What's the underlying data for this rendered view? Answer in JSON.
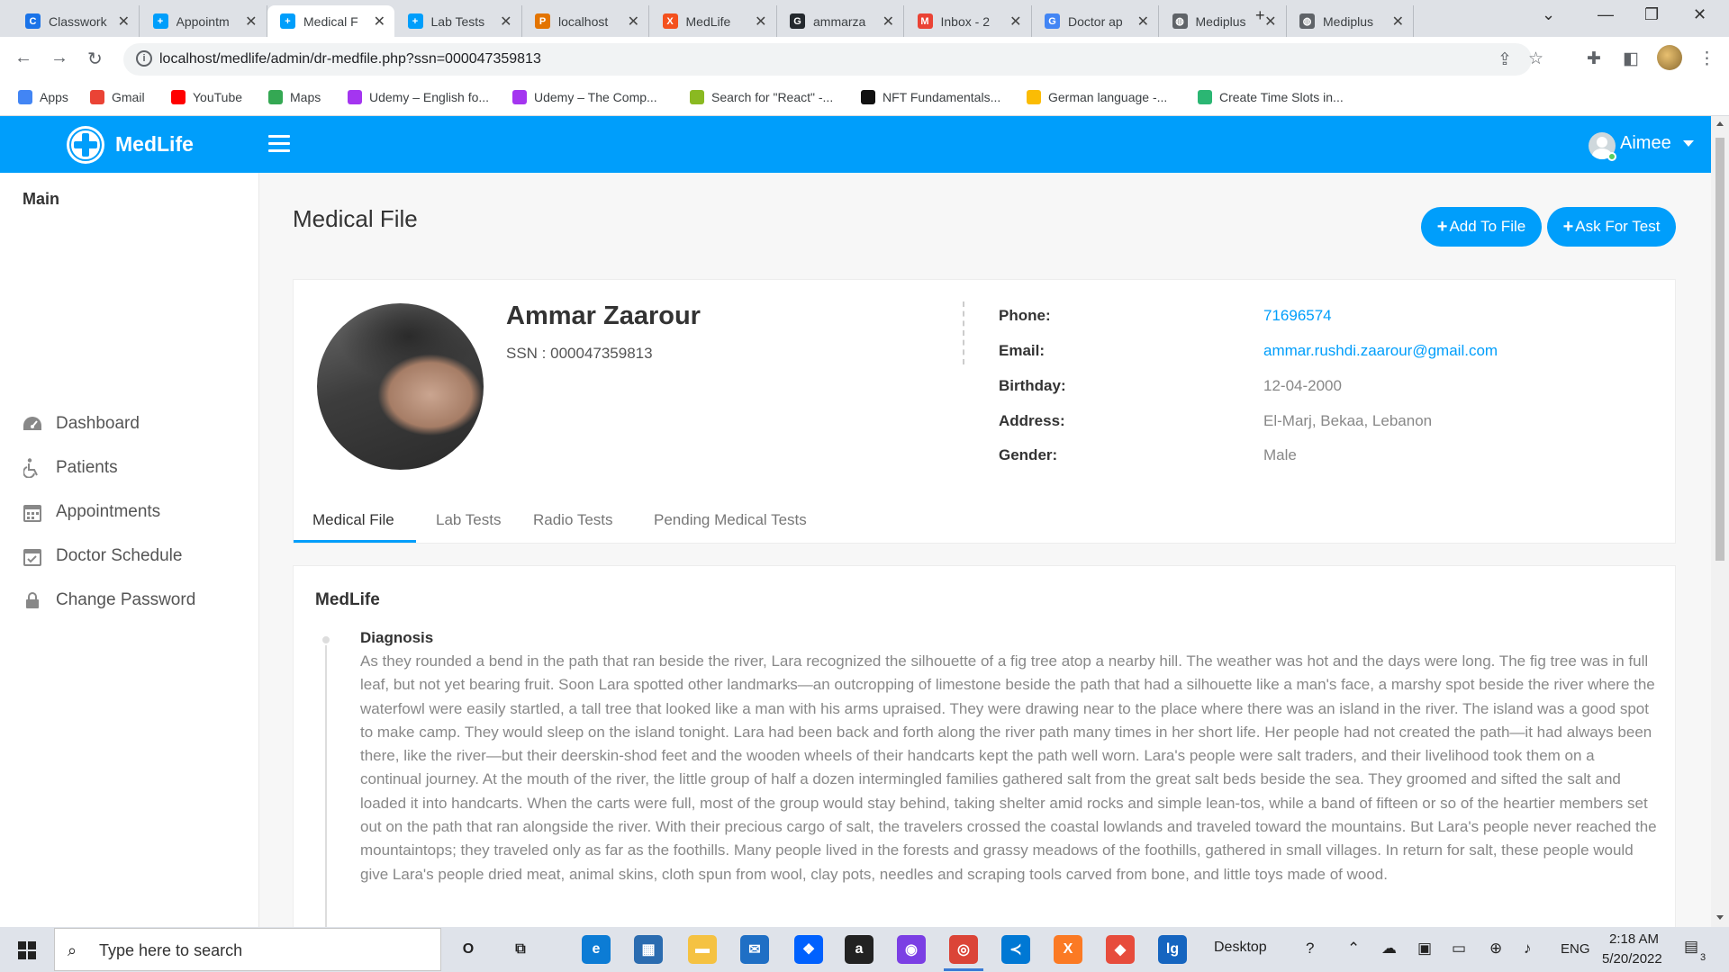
{
  "browser": {
    "tabs": [
      {
        "label": "Classwork",
        "favicon_color": "#1a73e8",
        "favicon_glyph": "C"
      },
      {
        "label": "Appointm",
        "favicon_color": "#009efb",
        "favicon_glyph": "+"
      },
      {
        "label": "Medical F",
        "favicon_color": "#009efb",
        "favicon_glyph": "+",
        "active": true
      },
      {
        "label": "Lab Tests",
        "favicon_color": "#009efb",
        "favicon_glyph": "+"
      },
      {
        "label": "localhost",
        "favicon_color": "#e37400",
        "favicon_glyph": "P"
      },
      {
        "label": "MedLife",
        "favicon_color": "#f4511e",
        "favicon_glyph": "X"
      },
      {
        "label": "ammarza",
        "favicon_color": "#24292e",
        "favicon_glyph": "G"
      },
      {
        "label": "Inbox - 2",
        "favicon_color": "#ea4335",
        "favicon_glyph": "M"
      },
      {
        "label": "Doctor ap",
        "favicon_color": "#4285f4",
        "favicon_glyph": "G"
      },
      {
        "label": "Mediplus",
        "favicon_color": "#5f6368",
        "favicon_glyph": "◍"
      },
      {
        "label": "Mediplus",
        "favicon_color": "#5f6368",
        "favicon_glyph": "◍"
      }
    ],
    "new_tab": "+",
    "url": "localhost/medlife/admin/dr-medfile.php?ssn=000047359813",
    "bookmarks": [
      {
        "label": "Apps",
        "color": "#4285f4"
      },
      {
        "label": "Gmail",
        "color": "#ea4335"
      },
      {
        "label": "YouTube",
        "color": "#ff0000"
      },
      {
        "label": "Maps",
        "color": "#34a853"
      },
      {
        "label": "Udemy – English fo...",
        "color": "#a435f0"
      },
      {
        "label": "Udemy – The Comp...",
        "color": "#a435f0"
      },
      {
        "label": "Search for \"React\" -...",
        "color": "#8ab921"
      },
      {
        "label": "NFT Fundamentals...",
        "color": "#111111"
      },
      {
        "label": "German language -...",
        "color": "#fbbc04"
      },
      {
        "label": "Create Time Slots in...",
        "color": "#2bb673"
      }
    ]
  },
  "app": {
    "brand": "MedLife",
    "user_name": "Aimee",
    "accent_color": "#009efb",
    "sidebar": {
      "section_title": "Main",
      "items": [
        {
          "label": "Dashboard",
          "icon": "dashboard-icon"
        },
        {
          "label": "Patients",
          "icon": "wheelchair-icon"
        },
        {
          "label": "Appointments",
          "icon": "calendar-icon"
        },
        {
          "label": "Doctor Schedule",
          "icon": "calendar-check-icon"
        },
        {
          "label": "Change Password",
          "icon": "lock-icon"
        }
      ]
    },
    "page": {
      "title": "Medical File",
      "buttons": {
        "add_to_file": "Add To File",
        "ask_for_test": "Ask For Test"
      }
    },
    "patient": {
      "name": "Ammar Zaarour",
      "ssn_label": "SSN : 000047359813",
      "fields": [
        {
          "label": "Phone:",
          "value": "71696574",
          "link": true
        },
        {
          "label": "Email:",
          "value": "ammar.rushdi.zaarour@gmail.com",
          "link": true
        },
        {
          "label": "Birthday:",
          "value": "12-04-2000",
          "link": false
        },
        {
          "label": "Address:",
          "value": "El-Marj, Bekaa, Lebanon",
          "link": false
        },
        {
          "label": "Gender:",
          "value": "Male",
          "link": false
        }
      ]
    },
    "tabs": [
      "Medical File",
      "Lab Tests",
      "Radio Tests",
      "Pending Medical Tests"
    ],
    "active_tab": "Medical File",
    "file": {
      "title": "MedLife",
      "entry_title": "Diagnosis",
      "entry_text": "As they rounded a bend in the path that ran beside the river, Lara recognized the silhouette of a fig tree atop a nearby hill. The weather was hot and the days were long. The fig tree was in full leaf, but not yet bearing fruit. Soon Lara spotted other landmarks—an outcropping of limestone beside the path that had a silhouette like a man's face, a marshy spot beside the river where the waterfowl were easily startled, a tall tree that looked like a man with his arms upraised. They were drawing near to the place where there was an island in the river. The island was a good spot to make camp. They would sleep on the island tonight. Lara had been back and forth along the river path many times in her short life. Her people had not created the path—it had always been there, like the river—but their deerskin-shod feet and the wooden wheels of their handcarts kept the path well worn. Lara's people were salt traders, and their livelihood took them on a continual journey. At the mouth of the river, the little group of half a dozen intermingled families gathered salt from the great salt beds beside the sea. They groomed and sifted the salt and loaded it into handcarts. When the carts were full, most of the group would stay behind, taking shelter amid rocks and simple lean-tos, while a band of fifteen or so of the heartier members set out on the path that ran alongside the river. With their precious cargo of salt, the travelers crossed the coastal lowlands and traveled toward the mountains. But Lara's people never reached the mountaintops; they traveled only as far as the foothills. Many people lived in the forests and grassy meadows of the foothills, gathered in small villages. In return for salt, these people would give Lara's people dried meat, animal skins, cloth spun from wool, clay pots, needles and scraping tools carved from bone, and little toys made of wood."
    }
  },
  "taskbar": {
    "search_placeholder": "Type here to search",
    "desktop_label": "Desktop",
    "language": "ENG",
    "time": "2:18 AM",
    "date": "5/20/2022",
    "notification_count": "3",
    "apps": [
      {
        "name": "cortana-icon",
        "glyph": "O",
        "color": "transparent"
      },
      {
        "name": "task-view-icon",
        "glyph": "⧉",
        "color": "transparent"
      },
      {
        "name": "edge-icon",
        "glyph": "e",
        "color": "#0c7cd5"
      },
      {
        "name": "store-icon",
        "glyph": "▦",
        "color": "#2b6cb0"
      },
      {
        "name": "file-explorer-icon",
        "glyph": "▬",
        "color": "#f5c242"
      },
      {
        "name": "mail-icon",
        "glyph": "✉",
        "color": "#1f6fc5"
      },
      {
        "name": "dropbox-icon",
        "glyph": "❖",
        "color": "#0061fe"
      },
      {
        "name": "amazon-icon",
        "glyph": "a",
        "color": "#222222"
      },
      {
        "name": "firefox-icon",
        "glyph": "◉",
        "color": "#7b3fe4"
      },
      {
        "name": "chrome-icon",
        "glyph": "◎",
        "color": "#db4437"
      },
      {
        "name": "vscode-icon",
        "glyph": "≺",
        "color": "#0078d4"
      },
      {
        "name": "xampp-icon",
        "glyph": "X",
        "color": "#fb7a24"
      },
      {
        "name": "sourcetree-icon",
        "glyph": "◆",
        "color": "#e74c3c"
      },
      {
        "name": "lg-app-icon",
        "glyph": "lg",
        "color": "#1565c0"
      }
    ]
  }
}
